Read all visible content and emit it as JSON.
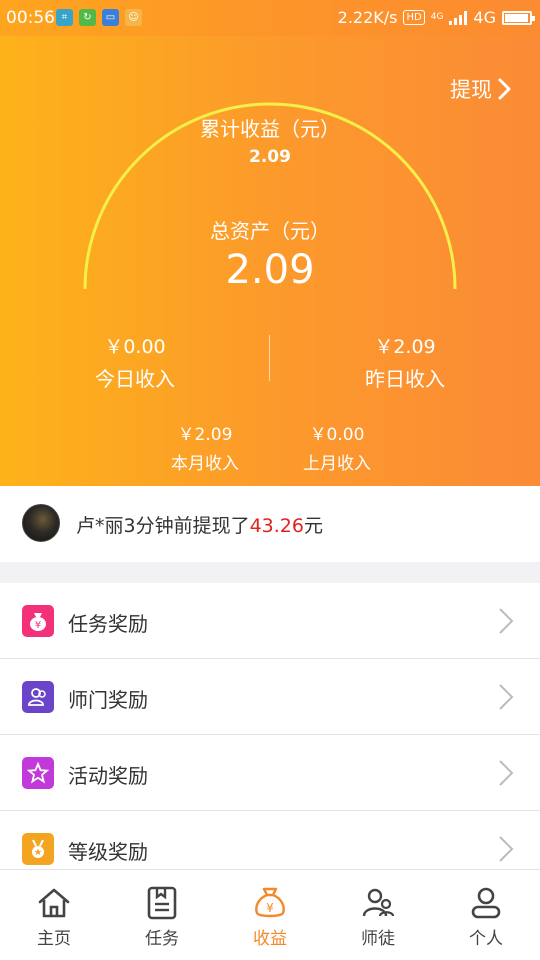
{
  "status_bar": {
    "time": "00:56",
    "speed": "2.22K/s",
    "hd": "HD",
    "network_small": "4G",
    "network": "4G"
  },
  "header": {
    "withdraw_label": "提现",
    "cumulative_label": "累计收益（元）",
    "cumulative_value": "2.09",
    "total_label": "总资产（元）",
    "total_value": "2.09",
    "today_value": "￥0.00",
    "today_label": "今日收入",
    "yesterday_value": "￥2.09",
    "yesterday_label": "昨日收入",
    "this_month_value": "￥2.09",
    "this_month_label": "本月收入",
    "last_month_value": "￥0.00",
    "last_month_label": "上月收入"
  },
  "notice": {
    "text_prefix": "卢*丽3分钟前提现了",
    "amount": "43.26",
    "unit": "元"
  },
  "menu": {
    "items": [
      {
        "label": "任务奖励",
        "icon": "money-bag-icon",
        "color": "#f2317a"
      },
      {
        "label": "师门奖励",
        "icon": "group-icon",
        "color": "#6a45c8"
      },
      {
        "label": "活动奖励",
        "icon": "star-icon",
        "color": "#c13ad9"
      },
      {
        "label": "等级奖励",
        "icon": "medal-icon",
        "color": "#f3a421"
      }
    ]
  },
  "tabs": [
    {
      "label": "主页",
      "icon": "home-icon"
    },
    {
      "label": "任务",
      "icon": "task-icon"
    },
    {
      "label": "收益",
      "icon": "earnings-icon",
      "active": true
    },
    {
      "label": "师徒",
      "icon": "mentor-icon"
    },
    {
      "label": "个人",
      "icon": "person-icon"
    }
  ],
  "colors": {
    "accent": "#f4892a",
    "gradient_start": "#fdb21a",
    "gradient_end": "#fb8b36",
    "arc": "#f4f04a",
    "amount_red": "#e0231f"
  }
}
